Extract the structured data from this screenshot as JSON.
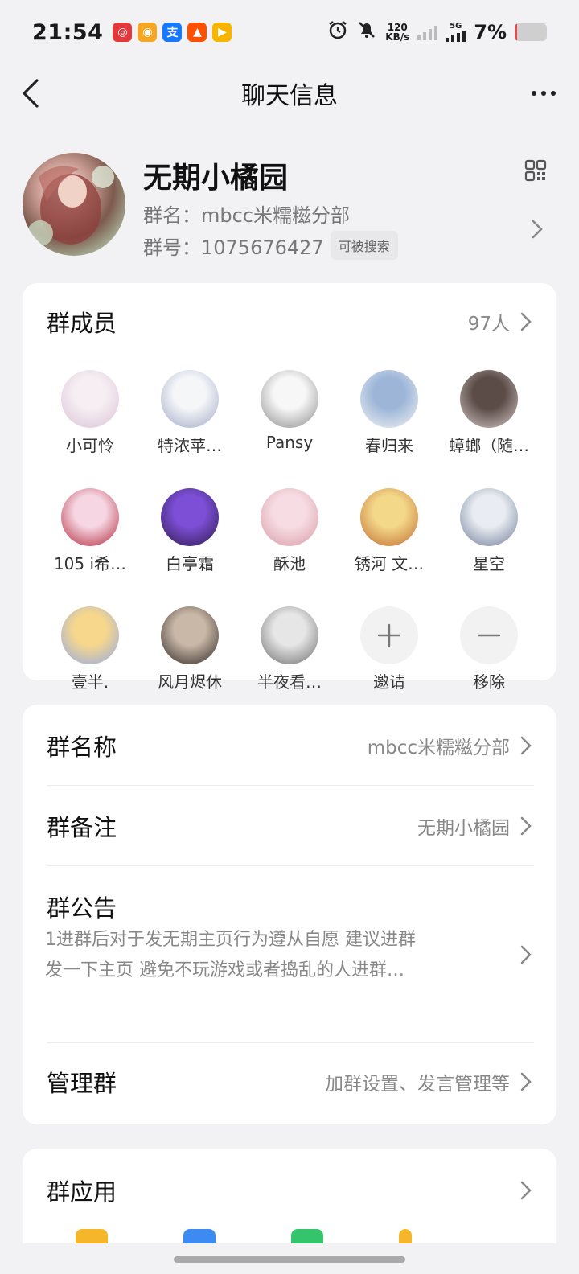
{
  "status_bar": {
    "time": "21:54",
    "app_icons": [
      {
        "name": "netease-music-icon",
        "color": "#e4393c",
        "glyph": "◎"
      },
      {
        "name": "weibo-icon",
        "color": "#f5a623",
        "glyph": "◉"
      },
      {
        "name": "alipay-icon",
        "color": "#1677ff",
        "glyph": "支"
      },
      {
        "name": "taobao-icon",
        "color": "#ff5000",
        "glyph": "▲"
      },
      {
        "name": "video-app-icon",
        "color": "#f7b500",
        "glyph": "▶"
      }
    ],
    "net_speed_value": "120",
    "net_speed_unit": "KB/s",
    "network": "5G",
    "battery_percent": "7%",
    "battery_level": 0.07,
    "battery_color": "#e5484d"
  },
  "header": {
    "title": "聊天信息"
  },
  "group": {
    "display_name": "无期小橘园",
    "name_line": "群名：mbcc米糯糍分部",
    "number_line": "群号：1075676427",
    "searchable_tag": "可被搜索"
  },
  "members": {
    "title": "群成员",
    "count": "97人",
    "items": [
      {
        "name": "小可怜",
        "colors": [
          "#f6eef3",
          "#d9c3d6"
        ]
      },
      {
        "name": "特浓苹…",
        "colors": [
          "#f4f6f8",
          "#9fa8c6"
        ]
      },
      {
        "name": "Pansy",
        "colors": [
          "#f7f7f7",
          "#8a8a8a"
        ]
      },
      {
        "name": "春归来",
        "colors": [
          "#9db6d8",
          "#f4f4f4"
        ]
      },
      {
        "name": "蟑螂（随…",
        "colors": [
          "#5b4c48",
          "#d6cbc6"
        ]
      },
      {
        "name": "105 i希…",
        "colors": [
          "#f6d6e2",
          "#b0253a"
        ]
      },
      {
        "name": "白亭霜",
        "colors": [
          "#7d4fd6",
          "#2b1a4a"
        ]
      },
      {
        "name": "酥池",
        "colors": [
          "#f7dde3",
          "#d89aa5"
        ]
      },
      {
        "name": "锈河 文…",
        "colors": [
          "#f3d88a",
          "#c06a2e"
        ]
      },
      {
        "name": "星空",
        "colors": [
          "#e9edf3",
          "#6e7b96"
        ]
      },
      {
        "name": "壹半.",
        "colors": [
          "#f7d78c",
          "#8fa9e8"
        ]
      },
      {
        "name": "风月烬休",
        "colors": [
          "#c9b8a8",
          "#2c2420"
        ]
      },
      {
        "name": "半夜看…",
        "colors": [
          "#e6e6e6",
          "#6b6b6b"
        ]
      }
    ],
    "invite_label": "邀请",
    "remove_label": "移除"
  },
  "settings": {
    "group_name_label": "群名称",
    "group_name_value": "mbcc米糯糍分部",
    "group_remark_label": "群备注",
    "group_remark_value": "无期小橘园",
    "notice_label": "群公告",
    "notice_body": "1进群后对于发无期主页行为遵从自愿 建议进群发一下主页 避免不玩游戏或者捣乱的人进群…",
    "manage_label": "管理群",
    "manage_value": "加群设置、发言管理等"
  },
  "apps": {
    "title": "群应用",
    "peek_colors": [
      "#f5b729",
      "#3d8bf2",
      "#34c46b",
      "#f5b729"
    ]
  }
}
